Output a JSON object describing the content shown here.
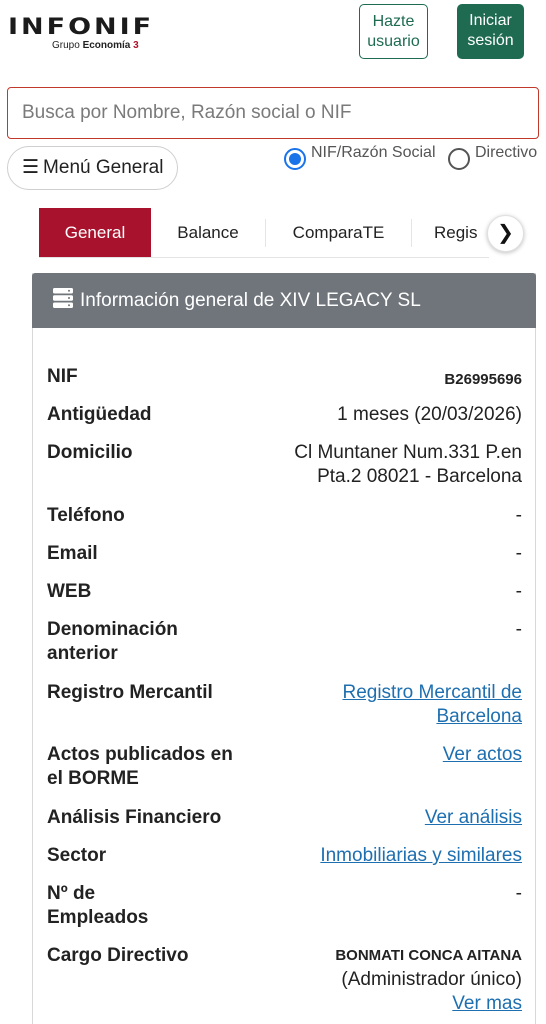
{
  "header": {
    "logo_text": "INFONIF",
    "logo_sub_prefix": "Grupo",
    "logo_sub_brand": "Economía",
    "logo_sub_num": "3",
    "register_label_1": "Hazte",
    "register_label_2": "usuario",
    "login_label_1": "Iniciar",
    "login_label_2": "sesión"
  },
  "search": {
    "placeholder": "Busca por Nombre, Razón social o NIF"
  },
  "menu": {
    "label": "Menú General"
  },
  "search_mode": {
    "options": [
      "NIF/Razón Social",
      "Directivo"
    ],
    "selected": "NIF/Razón Social"
  },
  "tabs": [
    {
      "label": "General",
      "active": true
    },
    {
      "label": "Balance",
      "active": false
    },
    {
      "label": "ComparaTE",
      "active": false
    },
    {
      "label": "Regis",
      "active": false
    }
  ],
  "card": {
    "title": "Información general de XIV LEGACY SL",
    "rows": [
      {
        "label": "NIF",
        "value": "B26995696"
      },
      {
        "label": "Antigüedad",
        "value": "1 meses (20/03/2026)"
      },
      {
        "label": "Domicilio",
        "value_1": "Cl Muntaner Num.331 P.en",
        "value_2": "Pta.2 08021 - Barcelona"
      },
      {
        "label": "Teléfono",
        "value": "-"
      },
      {
        "label": "Email",
        "value": "-"
      },
      {
        "label": "WEB",
        "value": "-"
      },
      {
        "label_1": "Denominación",
        "label_2": "anterior",
        "value": "-"
      },
      {
        "label": "Registro Mercantil",
        "value_1": "Registro Mercantil de",
        "value_2": "Barcelona"
      },
      {
        "label_1": "Actos publicados en",
        "label_2": "el BORME",
        "value": "Ver actos"
      },
      {
        "label": "Análisis Financiero",
        "value": "Ver análisis"
      },
      {
        "label": "Sector",
        "value": "Inmobiliarias y similares"
      },
      {
        "label_1": "Nº de",
        "label_2": "Empleados",
        "value": "-"
      },
      {
        "label": "Cargo Directivo",
        "value_name": "BONMATI CONCA AITANA",
        "value_role": "(Administrador único)",
        "value_link": "Ver mas"
      }
    ]
  },
  "colors": {
    "brand_green": "#1f6b52",
    "tab_active": "#a8122d",
    "card_header": "#6f757b",
    "link": "#1e6fb0",
    "search_border": "#c0392b"
  }
}
